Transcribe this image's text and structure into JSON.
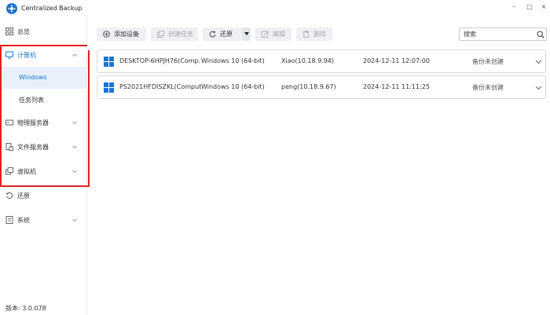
{
  "app": {
    "title": "Centralized Backup"
  },
  "window_controls": {
    "minimize": "–",
    "maximize": "□",
    "close": "×"
  },
  "sidebar": {
    "overview": "总览",
    "computer": "计算机",
    "computer_children": [
      "Windows",
      "任务列表"
    ],
    "physical_server": "物理服务器",
    "file_server": "文件服务器",
    "virtual_machine": "虚拟机",
    "restore": "还原",
    "system": "系统",
    "version": "版本: 3.0.078"
  },
  "toolbar": {
    "add_device": "添加设备",
    "create_task": "创建任务",
    "restore": "还原",
    "edit": "编辑",
    "delete": "删除",
    "search_placeholder": "搜索"
  },
  "devices": [
    {
      "name": "DESKTOP-6HPJH76(Comp...",
      "os": "Windows 10 (64-bit)",
      "user": "Xiao(10.18.9.94)",
      "time": "2024-12-11 12:07:00",
      "status": "备份未创建"
    },
    {
      "name": "PS2021HFDISZKL(Comput...",
      "os": "Windows 10 (64-bit)",
      "user": "peng(10.18.9.67)",
      "time": "2024-12-11 11:11:25",
      "status": "备份未创建"
    }
  ],
  "colors": {
    "accent": "#1a73d1",
    "highlight": "#e02020",
    "windows_logo": "#1a73d1"
  }
}
